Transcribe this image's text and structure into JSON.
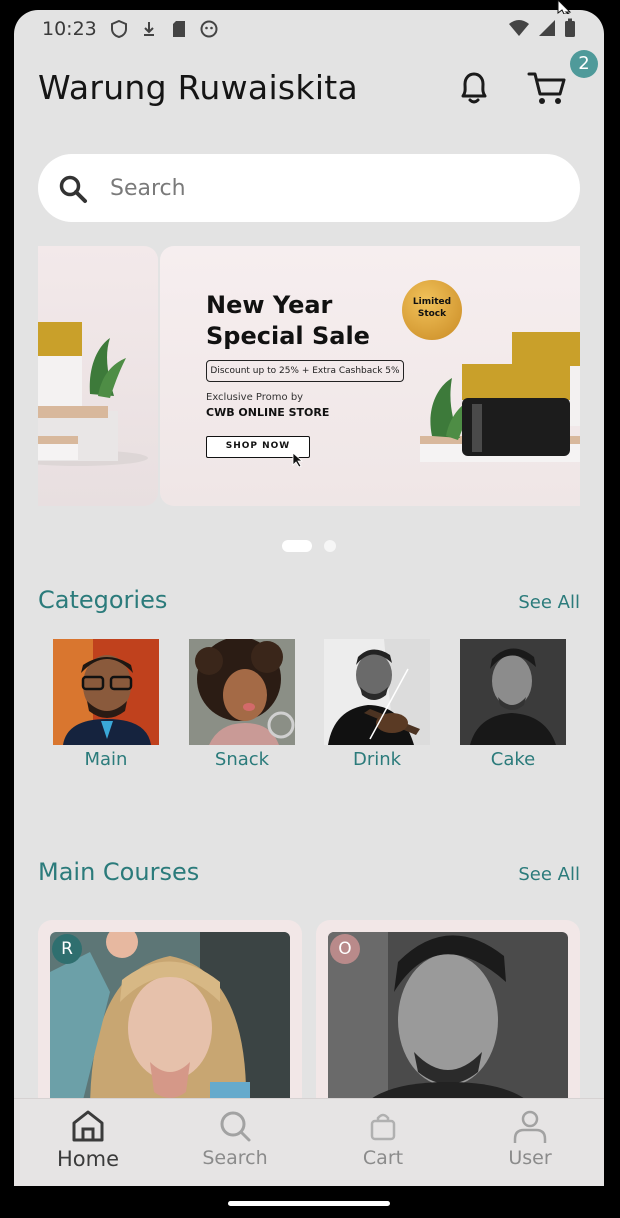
{
  "status_bar": {
    "time": "10:23",
    "icons": [
      "shield-icon",
      "download-icon",
      "sd-card-icon",
      "face-icon",
      "wifi-icon",
      "signal-icon",
      "battery-icon"
    ]
  },
  "header": {
    "title": "Warung Ruwaiskita",
    "cart_count": "2"
  },
  "search": {
    "placeholder": "Search"
  },
  "banner": {
    "title": "New Year Special Sale",
    "discount": "Discount up to 25% + Extra Cashback 5%",
    "promo": "Exclusive Promo by",
    "store": "CWB ONLINE STORE",
    "cta": "SHOP NOW",
    "badge": "Limited Stock",
    "active_slide": 1,
    "slide_count": 2
  },
  "categories": {
    "title": "Categories",
    "see_all": "See All",
    "items": [
      {
        "label": "Main"
      },
      {
        "label": "Snack"
      },
      {
        "label": "Drink"
      },
      {
        "label": "Cake"
      }
    ]
  },
  "main_courses": {
    "title": "Main Courses",
    "see_all": "See All",
    "items": [
      {
        "mark": "R",
        "mark_color": "#2f6f6f"
      },
      {
        "mark": "O",
        "mark_color": "#b98a8a"
      }
    ]
  },
  "bottom_nav": {
    "items": [
      {
        "label": "Home",
        "icon": "home-icon",
        "active": true
      },
      {
        "label": "Search",
        "icon": "search-icon",
        "active": false
      },
      {
        "label": "Cart",
        "icon": "bag-icon",
        "active": false
      },
      {
        "label": "User",
        "icon": "user-icon",
        "active": false
      }
    ]
  },
  "colors": {
    "accent": "#2b7b7b",
    "badge": "#4f9a9a",
    "background": "#e3e3e3"
  }
}
